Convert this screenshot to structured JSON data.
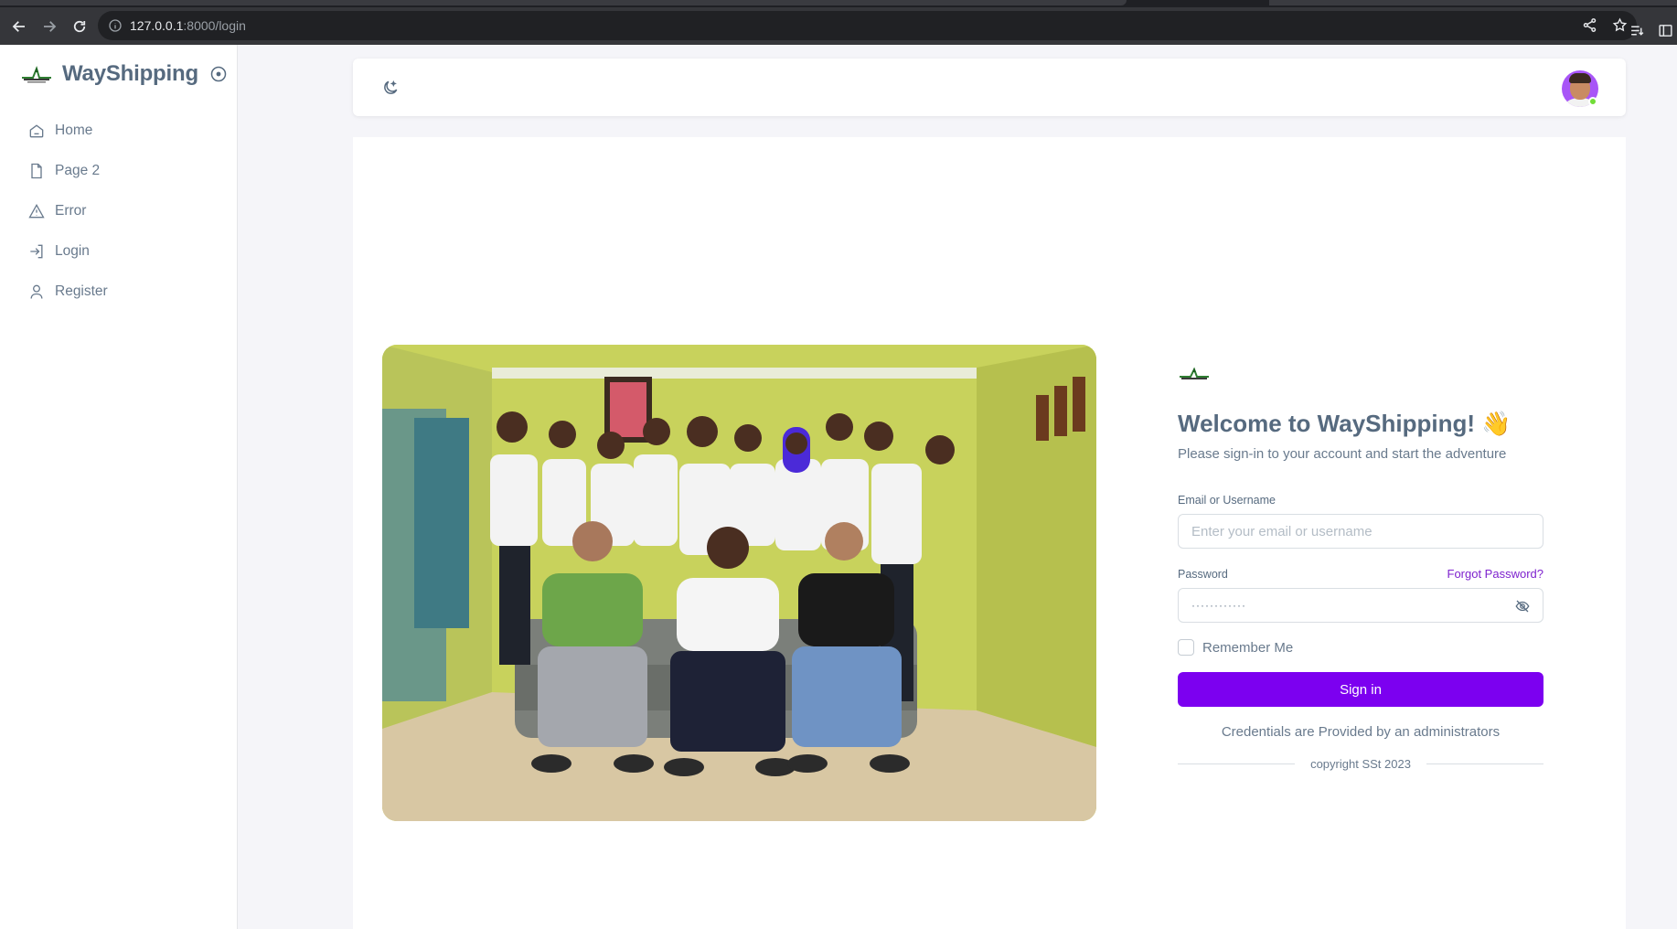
{
  "browser": {
    "url_host": "127.0.0.1",
    "url_path": ":8000/login"
  },
  "sidebar": {
    "brand": "WayShipping",
    "items": [
      {
        "label": "Home",
        "icon": "home-icon"
      },
      {
        "label": "Page 2",
        "icon": "file-icon"
      },
      {
        "label": "Error",
        "icon": "alert-icon"
      },
      {
        "label": "Login",
        "icon": "login-icon"
      },
      {
        "label": "Register",
        "icon": "user-icon"
      }
    ]
  },
  "navbar": {
    "theme_icon": "moon-icon",
    "avatar_status_color": "#71dd37"
  },
  "login": {
    "title": "Welcome to WayShipping! 👋",
    "subtitle": "Please sign-in to your account and start the adventure",
    "email_label": "Email or Username",
    "email_placeholder": "Enter your email or username",
    "password_label": "Password",
    "forgot_label": "Forgot Password?",
    "password_value": "············",
    "remember_label": "Remember Me",
    "signin_label": "Sign in",
    "credentials_note": "Credentials are Provided by an administrators",
    "copyright": "copyright SSt 2023"
  },
  "colors": {
    "primary": "#7c00f0",
    "link": "#7e22ce",
    "text": "#566a7f",
    "background": "#f5f5f9"
  }
}
